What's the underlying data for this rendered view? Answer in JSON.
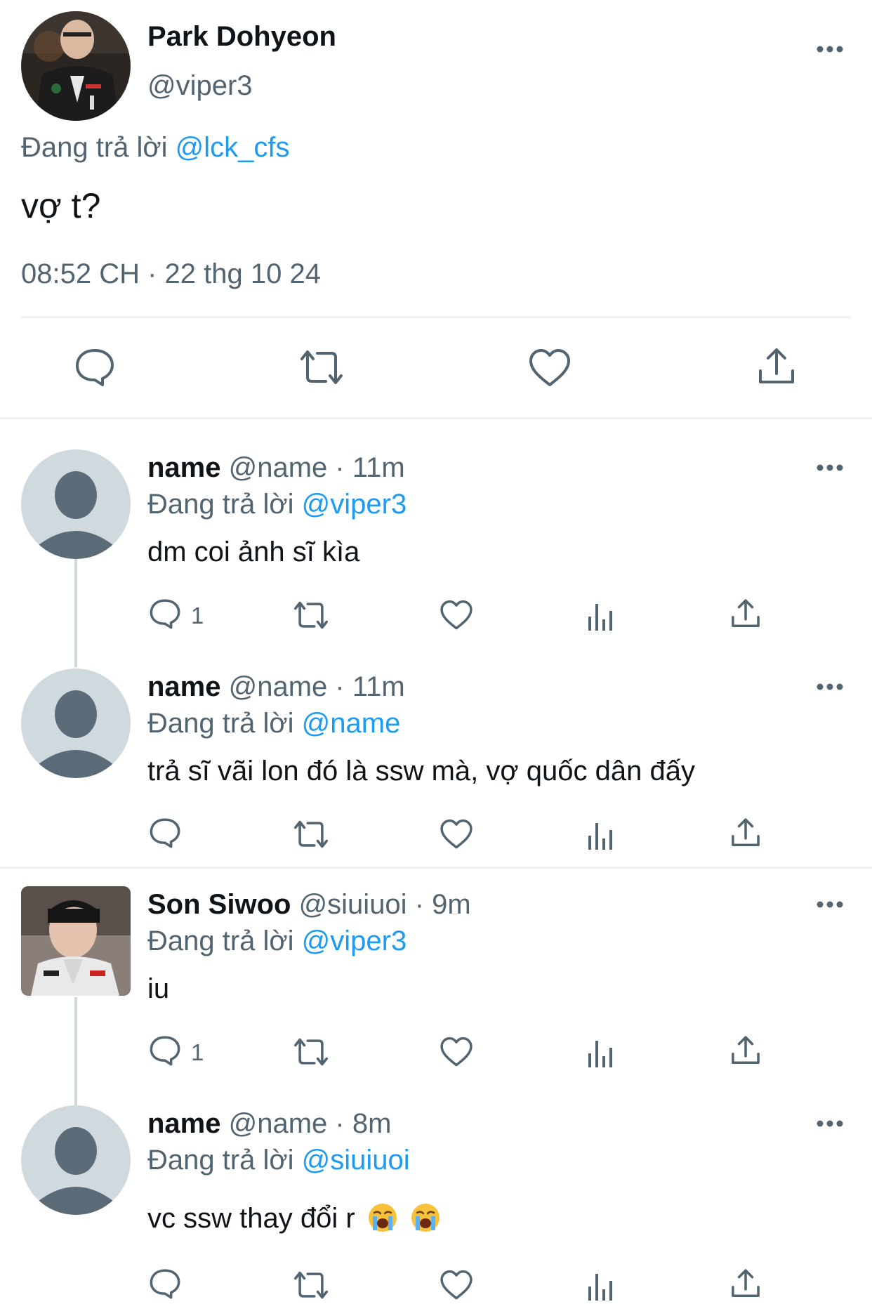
{
  "main_tweet": {
    "display_name": "Park Dohyeon",
    "handle": "@viper3",
    "reply_prefix": "Đang trả lời",
    "reply_to": "@lck_cfs",
    "text": "vợ t?",
    "timestamp": "08:52 CH · 22 thg 10 24"
  },
  "replies": [
    {
      "display_name": "name",
      "handle": "@name",
      "time": "· 11m",
      "reply_prefix": "Đang trả lời",
      "reply_to": "@viper3",
      "text": "dm coi ảnh sĩ kìa",
      "reply_count": "1"
    },
    {
      "display_name": "name",
      "handle": "@name",
      "time": "· 11m",
      "reply_prefix": "Đang trả lời",
      "reply_to": "@name",
      "text": "trả sĩ vãi lon đó là ssw mà, vợ quốc dân đấy",
      "reply_count": ""
    },
    {
      "display_name": "Son Siwoo",
      "handle": "@siuiuoi",
      "time": "· 9m",
      "reply_prefix": "Đang trả lời",
      "reply_to": "@viper3",
      "text": "iu",
      "reply_count": "1"
    },
    {
      "display_name": "name",
      "handle": "@name",
      "time": "· 8m",
      "reply_prefix": "Đang trả lời",
      "reply_to": "@siuiuoi",
      "text": "vc ssw thay đổi r",
      "reply_count": ""
    }
  ],
  "colors": {
    "link": "#1d9bf0",
    "muted": "#536471",
    "text": "#0f1419",
    "default_avatar": "#cfd9de",
    "divider": "#eff3f4"
  },
  "icons": [
    "more-icon",
    "reply-icon",
    "retweet-icon",
    "like-icon",
    "share-icon",
    "analytics-icon",
    "loudly-crying-face-emoji"
  ]
}
